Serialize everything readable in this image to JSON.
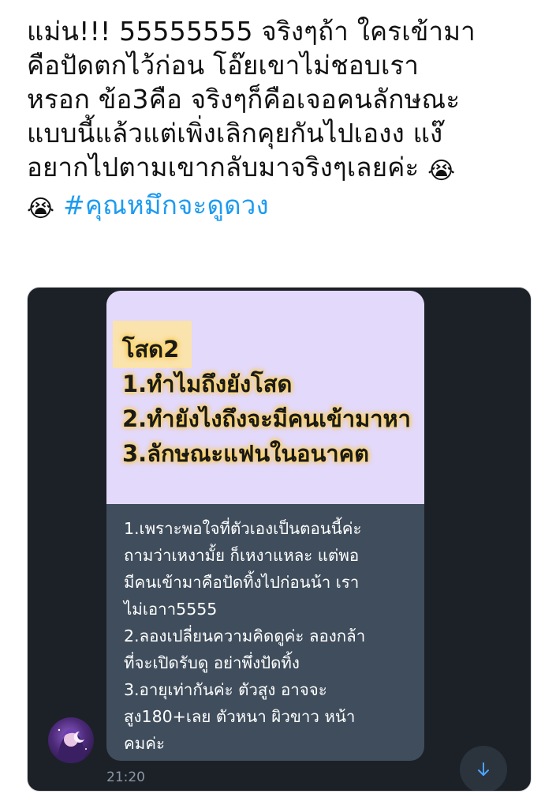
{
  "tweet": {
    "lines": [
      "แม่น!!! 55555555 จริงๆถ้า ใครเข้ามา",
      "คือปัดตกไว้ก่อน โอ๊ยเขาไม่ชอบเรา",
      "หรอก  ข้อ3คือ จริงๆก็คือเจอคนลักษณะ",
      "แบบนี้แล้วแต่เพิ่งเลิกคุยกันไปเองง แง๊",
      "อยากไปตามเขากลับมาจริงๆเลยค่ะ"
    ],
    "emoji": "😭",
    "hashtag": "#คุณหมึกจะดูดวง"
  },
  "chat": {
    "image_lines": [
      "โสด2",
      "1.ทำไมถึงยังโสด",
      "2.ทำยังไงถึงจะมีคนเข้ามาหา",
      "3.ลักษณะแฟนในอนาคต"
    ],
    "reply_lines": [
      "1.เพราะพอใจที่ตัวเองเป็นตอนนี้ค่ะ",
      "ถามว่าเหงามั้ย ก็เหงาแหละ แต่พอ",
      "มีคนเข้ามาคือปัดทิ้งไปก่อนน้า เรา",
      "ไม่เอาา5555",
      "2.ลองเปลี่ยนความคิดดูค่ะ ลองกล้า",
      "ที่จะเปิดรับดู อย่าพึ่งปัดทิ้ง",
      "3.อายุเท่ากันค่ะ ตัวสูง อาจจะ",
      "สูง180+เลย ตัวหนา ผิวขาว หน้า",
      "คมค่ะ"
    ],
    "time": "21:20",
    "scroll_icon": "arrow-down-icon"
  },
  "colors": {
    "hashtag": "#1d9bf0",
    "chat_background": "#1c2128",
    "image_bubble": "#e3d9fb",
    "reply_bubble": "#3f4d5c"
  }
}
